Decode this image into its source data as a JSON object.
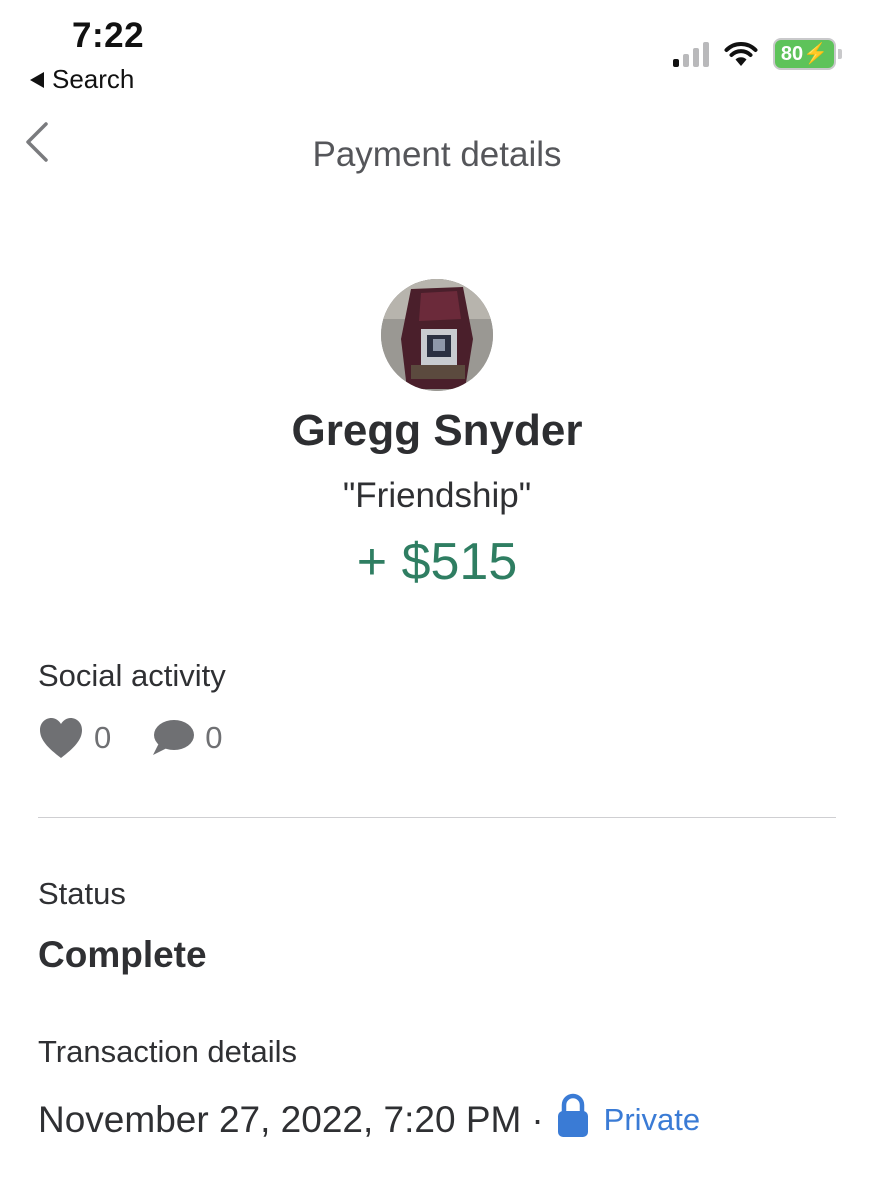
{
  "status_bar": {
    "time": "7:22",
    "back_label": "Search",
    "battery": "80"
  },
  "nav": {
    "title": "Payment details",
    "back_icon": "chevron-left-icon"
  },
  "profile": {
    "name": "Gregg Snyder",
    "note": "\"Friendship\"",
    "amount": "+ $515",
    "amount_color": "#2f7e62"
  },
  "social": {
    "label": "Social activity",
    "likes": "0",
    "comments": "0"
  },
  "status": {
    "label": "Status",
    "value": "Complete"
  },
  "transaction": {
    "label": "Transaction details",
    "datetime": "November 27, 2022, 7:20 PM",
    "separator": "·",
    "privacy": "Private",
    "privacy_color": "#3a7bd5"
  }
}
